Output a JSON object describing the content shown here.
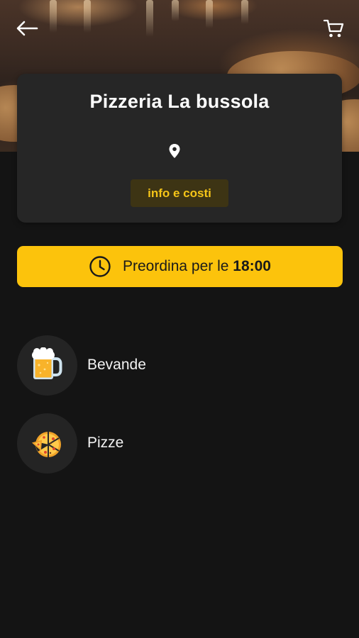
{
  "header": {
    "back_icon": "arrow-left-icon",
    "cart_icon": "cart-icon"
  },
  "restaurant": {
    "name": "Pizzeria La bussola",
    "location_icon": "location-pin-icon",
    "info_button_label": "info e costi"
  },
  "preorder": {
    "icon": "clock-icon",
    "label": "Preordina per le",
    "time": "18:00"
  },
  "categories": [
    {
      "label": "Bevande",
      "icon": "beer-mug-icon"
    },
    {
      "label": "Pizze",
      "icon": "pizza-slices-icon"
    }
  ],
  "colors": {
    "background": "#141414",
    "card": "#262626",
    "accent": "#fcc30c",
    "info_button_bg": "#3d3414",
    "info_button_text": "#f5c518"
  }
}
